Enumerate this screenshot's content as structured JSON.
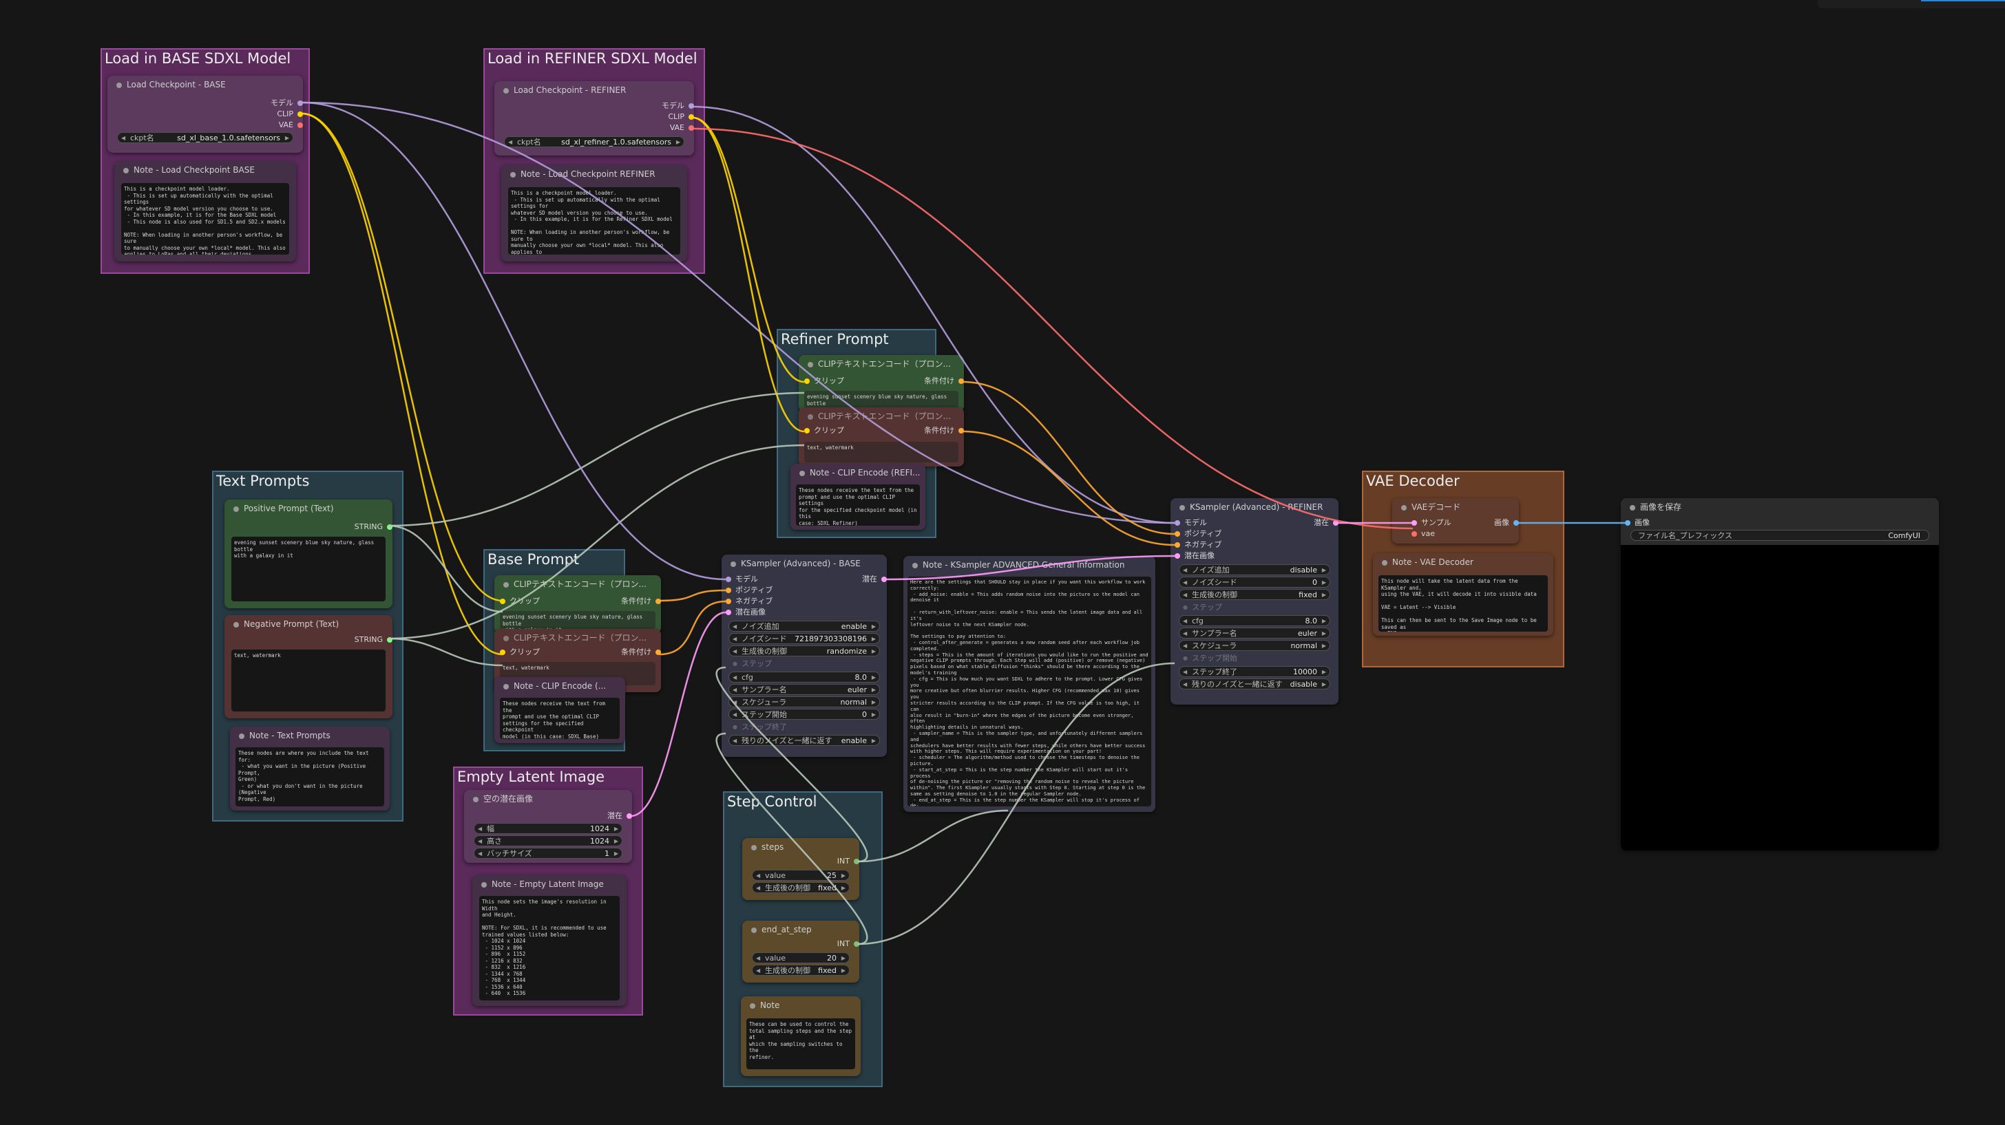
{
  "groups": {
    "base_model": "Load in BASE SDXL Model",
    "refiner_model": "Load in REFINER SDXL Model",
    "text_prompts": "Text Prompts",
    "refiner_prompt": "Refiner Prompt",
    "base_prompt": "Base Prompt",
    "empty_latent": "Empty Latent Image",
    "step_control": "Step Control",
    "vae_decoder": "VAE Decoder"
  },
  "ckpt_base": {
    "title": "Load Checkpoint - BASE",
    "out_model": "モデル",
    "out_clip": "CLIP",
    "out_vae": "VAE",
    "ckpt_label": "ckpt名",
    "ckpt_value": "sd_xl_base_1.0.safetensors"
  },
  "note_ckpt_base": {
    "title": "Note - Load Checkpoint BASE",
    "text": "This is a checkpoint model loader.\n - This is set up automatically with the optimal settings\nfor whatever SD model version you choose to use.\n - In this example, it is for the Base SDXL model\n - This node is also used for SD1.5 and SD2.x models\n\nNOTE: When loading in another person's workflow, be sure\nto manually choose your own *local* model. This also\napplies to LoRas and all their deviations"
  },
  "ckpt_refiner": {
    "title": "Load Checkpoint - REFINER",
    "out_model": "モデル",
    "out_clip": "CLIP",
    "out_vae": "VAE",
    "ckpt_label": "ckpt名",
    "ckpt_value": "sd_xl_refiner_1.0.safetensors"
  },
  "note_ckpt_refiner": {
    "title": "Note - Load Checkpoint REFINER",
    "text": "This is a checkpoint model loader.\n - This is set up automatically with the optimal settings for\nwhatever SD model version you choose to use.\n - In this example, it is for the Refiner SDXL model\n\nNOTE: When loading in another person's workflow, be sure to\nmanually choose your own *local* model. This also applies to\nLoRas and all their deviations."
  },
  "positive_prompt": {
    "title": "Positive Prompt (Text)",
    "out_string": "STRING",
    "text": "evening sunset scenery blue sky nature, glass bottle\nwith a galaxy in it"
  },
  "negative_prompt": {
    "title": "Negative Prompt (Text)",
    "out_string": "STRING",
    "text": "text, watermark"
  },
  "note_text_prompts": {
    "title": "Note - Text Prompts",
    "text": "These nodes are where you include the text for:\n - what you want in the picture (Positive Prompt,\nGreen)\n - or what you don't want in the picture (Negative\nPrompt, Red)\n\nThis node type is called a \"PrimitiveNode\" if you\nare searching for the node type."
  },
  "refiner_clip_pos": {
    "title": "CLIPテキストエンコード（プロン...",
    "in_clip": "クリップ",
    "out_cond": "条件付け",
    "text": "evening sunset scenery blue sky nature, glass bottle\nwith a galaxy in it"
  },
  "refiner_clip_neg": {
    "title": "CLIPテキストエンコード（プロン...",
    "in_clip": "クリップ",
    "out_cond": "条件付け",
    "text": "text, watermark"
  },
  "note_refiner_clip": {
    "title": "Note - CLIP Encode (REFI...",
    "text": "These nodes receive the text from the\nprompt and use the optimal CLIP settings\nfor the specified checkpoint model (in this\ncase: SDXL Refiner)"
  },
  "base_clip_pos": {
    "title": "CLIPテキストエンコード（プロン...",
    "in_clip": "クリップ",
    "out_cond": "条件付け",
    "text": "evening sunset scenery blue sky nature, glass bottle\nwith a galaxy in it"
  },
  "base_clip_neg": {
    "title": "CLIPテキストエンコード（プロン...",
    "in_clip": "クリップ",
    "out_cond": "条件付け",
    "text": "text, watermark"
  },
  "note_base_clip": {
    "title": "Note - CLIP Encode (...",
    "text": "These nodes receive the text from the\nprompt and use the optimal CLIP\nsettings for the specified checkpoint\nmodel (in this case: SDXL Base)"
  },
  "empty_latent_node": {
    "title": "空の潜在画像",
    "out_latent": "潜在",
    "w_label": "幅",
    "w_value": "1024",
    "h_label": "高さ",
    "h_value": "1024",
    "b_label": "バッチサイズ",
    "b_value": "1"
  },
  "note_empty_latent": {
    "title": "Note - Empty Latent Image",
    "text": "This node sets the image's resolution in Width\nand Height.\n\nNOTE: For SDXL, it is recommended to use\ntrained values listed below:\n - 1024 x 1024\n - 1152 x 896\n - 896  x 1152\n - 1216 x 832\n - 832  x 1216\n - 1344 x 768\n - 768  x 1344\n - 1536 x 640\n - 640  x 1536"
  },
  "ksampler_base": {
    "title": "KSampler (Advanced) - BASE",
    "in_model": "モデル",
    "in_pos": "ポジティブ",
    "in_neg": "ネガティブ",
    "in_latent": "潜在画像",
    "out_latent": "潜在",
    "w_noise_label": "ノイズ追加",
    "w_noise": "enable",
    "w_seed_label": "ノイズシード",
    "w_seed": "721897303308196",
    "w_ctrl_label": "生成後の制御",
    "w_ctrl": "randomize",
    "w_steps_label": "ステップ",
    "w_cfg_label": "cfg",
    "w_cfg": "8.0",
    "w_sampler_label": "サンプラー名",
    "w_sampler": "euler",
    "w_sched_label": "スケジューラ",
    "w_sched": "normal",
    "w_start_label": "ステップ開始",
    "w_start": "0",
    "w_end_label": "ステップ終了",
    "w_ret_label": "残りのノイズと一緒に返す",
    "w_ret": "enable"
  },
  "note_ksampler": {
    "title": "Note - KSampler ADVANCED General Information",
    "text": "Here are the settings that SHOULD stay in place if you want this workflow to work\ncorrectly:\n - add_noise: enable = This adds random noise into the picture so the model can\ndenoise it\n\n - return_with_leftover_noise: enable = This sends the latent image data and all it's\nleftover noise to the next KSampler node.\n\nThe settings to pay attention to:\n - control_after_generate = generates a new random seed after each workflow job\ncompleted.\n - steps = This is the amount of iterations you would like to run the positive and\nnegative CLIP prompts through. Each Step will add (positive) or remove (negative)\npixels based on what stable diffusion \"thinks\" should be there according to the\nmodel's training\n - cfg = This is how much you want SDXL to adhere to the prompt. Lower CFG gives you\nmore creative but often blurrier results. Higher CFG (recommended max 10) gives you\nstricter results according to the CLIP prompt. If the CFG value is too high, it can\nalso result in \"burn-in\" where the edges of the picture become even stronger, often\nhighlighting details in unnatural ways.\n - sampler_name = This is the sampler type, and unfortunately different samplers and\nschedulers have better results with fewer steps, while others have better success\nwith higher steps. This will require experimentation on your part!\n - scheduler = The algorithm/method used to choose the timesteps to denoise the\npicture.\n - start_at_step = This is the step number the KSampler will start out it's process\nof de-noising the picture or \"removing the random noise to reveal the picture\nwithin\". The first KSampler usually starts with Step 0. Starting at step 0 is the\nsame as setting denoise to 1.0 in the regular Sampler node.\n - end_at_step = This is the step number the KSampler will stop it's process of de-\nnoising the picture. If there is any remaining leftover noise and\nreturn_with_leftover_noise is enabled, then it will pass on the left over noise to\nthe next KSampler (assuming there is another one)."
  },
  "ksampler_refiner": {
    "title": "KSampler (Advanced) - REFINER",
    "in_model": "モデル",
    "in_pos": "ポジティブ",
    "in_neg": "ネガティブ",
    "in_latent": "潜在画像",
    "out_latent": "潜在",
    "w_noise_label": "ノイズ追加",
    "w_noise": "disable",
    "w_seed_label": "ノイズシード",
    "w_seed": "0",
    "w_ctrl_label": "生成後の制御",
    "w_ctrl": "fixed",
    "w_steps_label": "ステップ",
    "w_cfg_label": "cfg",
    "w_cfg": "8.0",
    "w_sampler_label": "サンプラー名",
    "w_sampler": "euler",
    "w_sched_label": "スケジューラ",
    "w_sched": "normal",
    "w_start_label": "ステップ開始",
    "w_end_label": "ステップ終了",
    "w_end": "10000",
    "w_ret_label": "残りのノイズと一緒に返す",
    "w_ret": "disable"
  },
  "steps_node": {
    "title": "steps",
    "out_int": "INT",
    "value_label": "value",
    "value": "25",
    "ctrl_label": "生成後の制御",
    "ctrl": "fixed"
  },
  "end_at_step_node": {
    "title": "end_at_step",
    "out_int": "INT",
    "value_label": "value",
    "value": "20",
    "ctrl_label": "生成後の制御",
    "ctrl": "fixed"
  },
  "note_steps": {
    "title": "Note",
    "text": "These can be used to control the\ntotal sampling steps and the step at\nwhich the sampling switches to the\nrefiner."
  },
  "vae_decode": {
    "title": "VAEデコード",
    "in_samples": "サンプル",
    "in_vae": "vae",
    "out_image": "画像"
  },
  "note_vae": {
    "title": "Note - VAE Decoder",
    "text": "This node will take the latent data from the KSampler and,\nusing the VAE, it will decode it into visible data\n\nVAE = Latent --> Visible\n\nThis can then be sent to the Save Image node to be saved as\na PNG."
  },
  "save_image": {
    "title": "画像を保存",
    "in_images": "画像",
    "prefix_label": "ファイル名_プレフィックス",
    "prefix_value": "ComfyUI"
  },
  "colors": {
    "model": "#b39ddb",
    "clip": "#ffd500",
    "vae": "#ff6e6e",
    "conditioning": "#ffa931",
    "latent": "#ff9cf9",
    "image": "#64b5f6",
    "string": "#77ff77",
    "int": "#7fbf7f"
  }
}
